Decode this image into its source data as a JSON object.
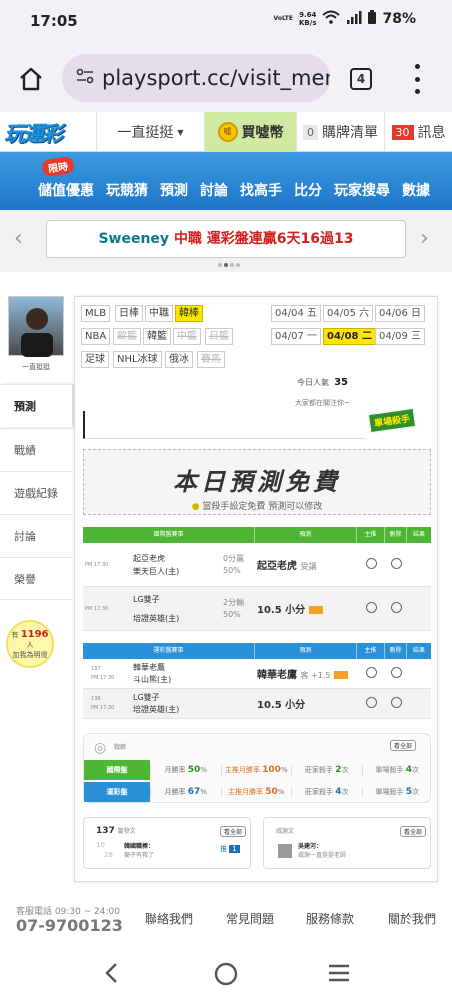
{
  "status_bar": {
    "time": "17:05",
    "net_type": "VoLTE",
    "net_speed": "9.64",
    "net_unit": "KB/s",
    "battery": "78%"
  },
  "browser": {
    "url": "playsport.cc/visit_mem",
    "tab_count": "4"
  },
  "site_header": {
    "logo": "玩運彩",
    "dropdown": "一直挺挺",
    "coin_icon_text": "噓",
    "coin_label": "買噓幣",
    "cart_count": "0",
    "cart_label": "購牌清單",
    "msg_count": "30",
    "msg_label": "訊息"
  },
  "nav": {
    "limited_badge": "限時",
    "items": [
      "儲值優惠",
      "玩競猜",
      "預測",
      "討論",
      "找高手",
      "比分",
      "玩家搜尋",
      "數據"
    ]
  },
  "banner": {
    "prefix": "Sweeney",
    "highlight": "中職 運彩盤連贏6天16過13",
    "prev": "‹",
    "next": "›"
  },
  "sidebar": {
    "avatar_name": "一直挺挺",
    "menu": [
      "預測",
      "戰績",
      "遊戲紀錄",
      "討論",
      "榮譽"
    ],
    "fans_prefix": "有",
    "fans_count": "1196",
    "fans_unit": "人",
    "fans_suffix": "加我為明燈"
  },
  "leagues": {
    "row1": [
      "MLB",
      "日棒",
      "中職",
      "韓棒"
    ],
    "row2": [
      "NBA",
      "歐籃",
      "韓籃",
      "中籃",
      "日籃"
    ],
    "row3": [
      "足球",
      "NHL冰球",
      "俄冰",
      "賽馬"
    ],
    "selected": "韓棒"
  },
  "dates": {
    "row1": [
      "04/04 五",
      "04/05 六",
      "04/06 日"
    ],
    "row2": [
      "04/07 一",
      "04/08 二",
      "04/09 三"
    ],
    "selected": "04/08 二"
  },
  "today_popular": {
    "label": "今日人氣",
    "count": "35",
    "sub": "大家都在關注你~"
  },
  "killer_ribbon": "單場殺手",
  "free_banner": {
    "title": "本日預測免費",
    "sub": "當殺手設定免費 預測可以修改"
  },
  "intl_table": {
    "headers": [
      "國際盤賽事",
      "預測",
      "主推",
      "刪除",
      "結果"
    ],
    "rows": [
      {
        "time": "PM 17:30",
        "team1": "起亞老虎",
        "team2": "樂天巨人(主)",
        "line1": "0分贏",
        "line2": "50%",
        "pick": "起亞老虎",
        "pick_note": "受讓"
      },
      {
        "time": "PM 17:30",
        "team1": "LG雙子",
        "team2": "培證英雄(主)",
        "line1": "2分輸",
        "line2": "50%",
        "pick": "10.5 小分",
        "pick_note": ""
      }
    ]
  },
  "lottery_table": {
    "headers": [
      "運彩盤賽事",
      "預測",
      "主推",
      "刪除",
      "結果"
    ],
    "rows": [
      {
        "num": "137",
        "time": "PM 17:30",
        "team1": "韓華老鷹",
        "team2": "斗山熊(主)",
        "pick": "韓華老鷹",
        "pick_note": "客 +1.5"
      },
      {
        "num": "136",
        "time": "PM 17:30",
        "team1": "LG雙子",
        "team2": "培證英雄(主)",
        "pick": "10.5 小分",
        "pick_note": ""
      }
    ]
  },
  "stats": {
    "title": "戰績",
    "view_all": "看全部",
    "intl": {
      "label": "國際盤",
      "month_win_label": "月勝率",
      "month_win": "50",
      "main_month_label": "主推月勝率",
      "main_month": "100",
      "streak_label": "莊家殺手",
      "streak": "2",
      "single_label": "單場殺手",
      "single": "4",
      "unit_pct": "%",
      "unit_times": "次"
    },
    "lottery": {
      "label": "運彩盤",
      "month_win_label": "月勝率",
      "month_win": "67",
      "main_month_label": "主推月勝率",
      "main_month": "50",
      "streak_label": "莊家殺手",
      "streak": "4",
      "single_label": "單場殺手",
      "single": "5",
      "unit_pct": "%",
      "unit_times": "次"
    }
  },
  "posts_panel": {
    "count": "137",
    "label": "篇發文",
    "view_all": "看全部",
    "item_month": "10",
    "item_day": "28",
    "item_author": "韓國職棒：",
    "item_text": "獅子有救了",
    "item_tag": "推",
    "item_num": "1"
  },
  "reply_panel": {
    "label": "威謝文",
    "view_all": "看全部",
    "item_author": "吳建河：",
    "item_text": "威謝一直挺挺老師"
  },
  "footer": {
    "svc_label": "客服電話 09:30 ~ 24:00",
    "phone": "07-9700123",
    "links": [
      "聯絡我們",
      "常見問題",
      "服務條款",
      "關於我們"
    ]
  },
  "colors": {
    "green": "#4fb534",
    "blue": "#2a90d8",
    "yellow": "#ffe600",
    "red": "#e03b2f"
  }
}
